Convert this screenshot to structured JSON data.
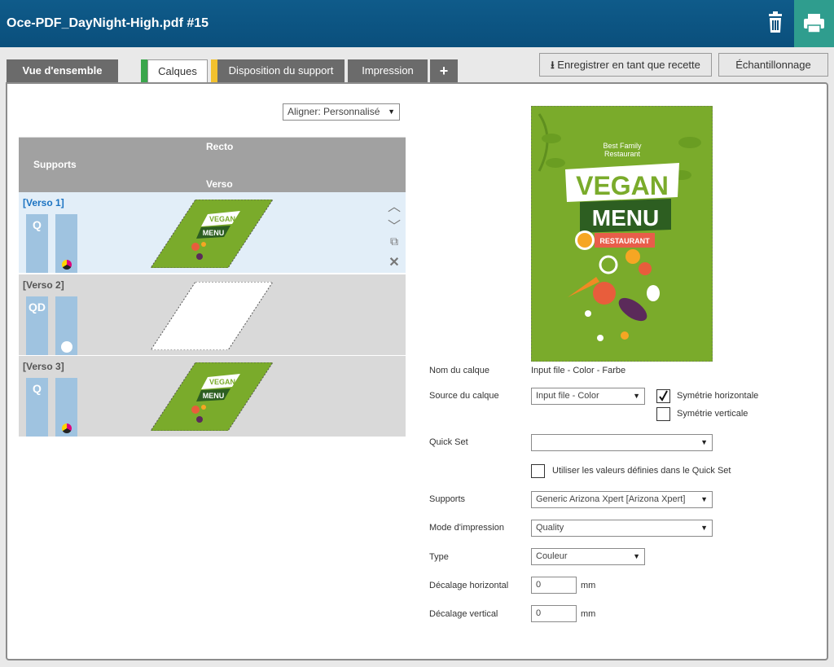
{
  "header": {
    "title": "Oce-PDF_DayNight-High.pdf #15",
    "trash_icon": "trash-icon",
    "print_icon": "printer-icon"
  },
  "tabs": [
    {
      "label": "Vue d'ensemble"
    },
    {
      "label": "Calques"
    },
    {
      "label": "Disposition du support"
    },
    {
      "label": "Impression"
    },
    {
      "label": "+"
    }
  ],
  "actions": {
    "save_recipe": "Enregistrer en tant que recette",
    "sampling": "Échantillonnage"
  },
  "align": {
    "value": "Aligner: Personnalisé"
  },
  "table": {
    "supports": "Supports",
    "recto": "Recto",
    "verso": "Verso",
    "rows": [
      {
        "label": "[Verso 1]",
        "mode": "Q",
        "selected": true
      },
      {
        "label": "[Verso 2]",
        "mode": "QD",
        "selected": false
      },
      {
        "label": "[Verso 3]",
        "mode": "Q",
        "selected": false
      }
    ]
  },
  "preview": {
    "small_text_1": "Best Family",
    "small_text_2": "Restaurant",
    "vegan": "VEGAN",
    "menu": "MENU",
    "restaurant": "RESTAURANT"
  },
  "form": {
    "layer_name_label": "Nom du calque",
    "layer_name_value": "Input file - Color - Farbe",
    "layer_source_label": "Source du calque",
    "layer_source_value": "Input file - Color",
    "mirror_h_label": "Symétrie horizontale",
    "mirror_h_checked": true,
    "mirror_v_label": "Symétrie verticale",
    "mirror_v_checked": false,
    "quickset_label": "Quick Set",
    "quickset_value": "",
    "use_quickset_label": "Utiliser les valeurs définies dans le Quick Set",
    "media_label": "Supports",
    "media_value": "Generic Arizona Xpert [Arizona Xpert]",
    "print_mode_label": "Mode d'impression",
    "print_mode_value": "Quality",
    "type_label": "Type",
    "type_value": "Couleur",
    "h_offset_label": "Décalage horizontal",
    "h_offset_value": "0",
    "v_offset_label": "Décalage vertical",
    "v_offset_value": "0",
    "unit": "mm"
  },
  "colors": {
    "header": "#0a4f7c",
    "print_button": "#2f9d8e",
    "selected_row": "#e2eef8",
    "poster_green": "#7aab2b"
  }
}
